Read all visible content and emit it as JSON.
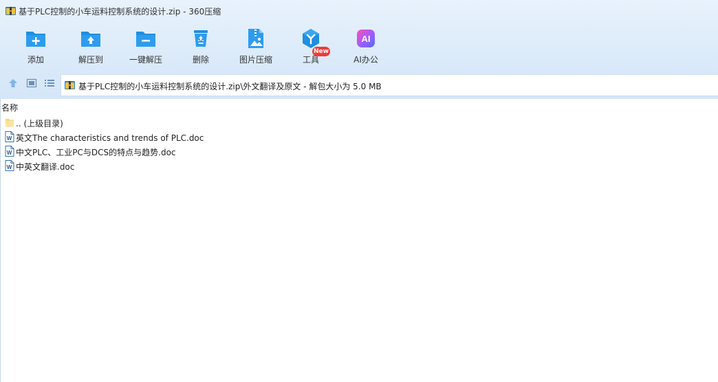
{
  "window": {
    "title": "基于PLC控制的小车运料控制系统的设计.zip - 360压缩",
    "app_icon": "archive-icon"
  },
  "toolbar": {
    "items": [
      {
        "label": "添加",
        "icon": "add-folder-icon"
      },
      {
        "label": "解压到",
        "icon": "extract-to-icon"
      },
      {
        "label": "一键解压",
        "icon": "one-click-extract-icon"
      },
      {
        "label": "删除",
        "icon": "recycle-bin-icon"
      },
      {
        "label": "图片压缩",
        "icon": "image-compress-icon"
      },
      {
        "label": "工具",
        "icon": "tools-icon",
        "badge": "New"
      },
      {
        "label": "AI办公",
        "icon": "ai-office-icon",
        "icon_text": "AI"
      }
    ]
  },
  "navbar": {
    "path": "基于PLC控制的小车运料控制系统的设计.zip\\外文翻译及原文 - 解包大小为 5.0 MB"
  },
  "file_list": {
    "column_name": "名称",
    "items": [
      {
        "name": ".. (上级目录)",
        "type": "folder"
      },
      {
        "name": "英文The characteristics and trends of PLC.doc",
        "type": "doc"
      },
      {
        "name": "中文PLC、工业PC与DCS的特点与趋势.doc",
        "type": "doc"
      },
      {
        "name": "中英文翻译.doc",
        "type": "doc"
      }
    ]
  },
  "colors": {
    "accent_blue": "#1f8fe0",
    "ai_gradient_start": "#ff4fb0",
    "ai_gradient_end": "#4f6dff",
    "badge_red": "#ef3b36"
  }
}
